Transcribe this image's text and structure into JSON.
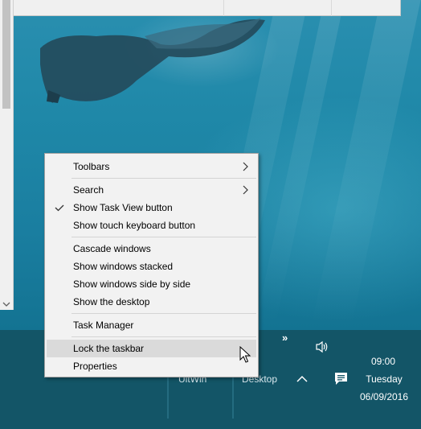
{
  "menu": {
    "items": [
      {
        "label": "Toolbars",
        "submenu": true
      },
      {
        "label": "Search",
        "submenu": true
      },
      {
        "label": "Show Task View button",
        "checked": true
      },
      {
        "label": "Show touch keyboard button"
      },
      {
        "label": "Cascade windows"
      },
      {
        "label": "Show windows stacked"
      },
      {
        "label": "Show windows side by side"
      },
      {
        "label": "Show the desktop"
      },
      {
        "label": "Task Manager"
      },
      {
        "label": "Lock the taskbar",
        "highlighted": true
      },
      {
        "label": "Properties"
      }
    ]
  },
  "taskbar": {
    "toolbar_1": "UltWin",
    "toolbar_2": "Desktop",
    "overflow_glyph": "»",
    "time": "09:00",
    "day": "Tuesday",
    "date": "06/09/2016"
  },
  "icons": {
    "submenu_arrow": "chevron-right-icon",
    "check": "checkmark-icon",
    "volume": "speaker-icon",
    "show_hidden": "chevron-up-icon",
    "action_center": "action-center-icon",
    "cursor": "mouse-pointer-icon"
  },
  "colors": {
    "taskbar": "#135567",
    "menu_bg": "#f2f2f2",
    "menu_highlight": "#dadada",
    "wallpaper": "#1f88a8"
  }
}
